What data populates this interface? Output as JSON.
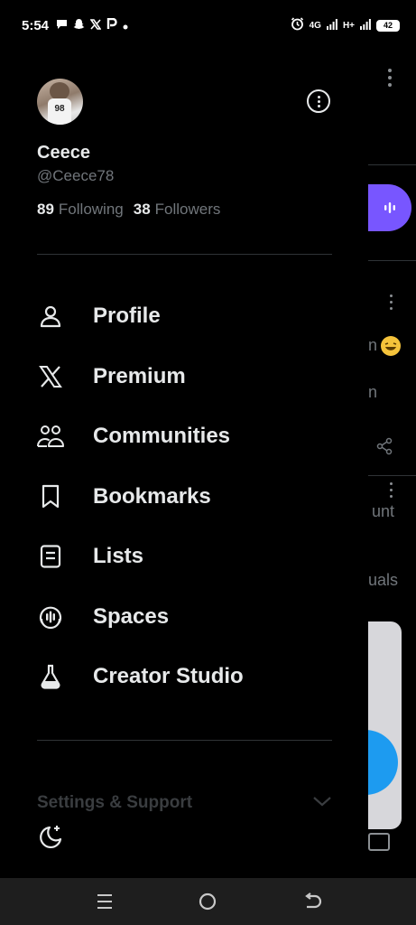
{
  "status_bar": {
    "time": "5:54",
    "network_1": "4G",
    "network_2": "H+",
    "battery": "42"
  },
  "profile": {
    "display_name": "Ceece",
    "handle": "@Ceece78",
    "following_count": "89",
    "following_label": "Following",
    "followers_count": "38",
    "followers_label": "Followers",
    "avatar_jersey": "98"
  },
  "menu": {
    "items": [
      {
        "label": "Profile",
        "icon": "person-icon"
      },
      {
        "label": "Premium",
        "icon": "x-logo-icon"
      },
      {
        "label": "Communities",
        "icon": "communities-icon"
      },
      {
        "label": "Bookmarks",
        "icon": "bookmark-icon"
      },
      {
        "label": "Lists",
        "icon": "list-icon"
      },
      {
        "label": "Spaces",
        "icon": "spaces-icon"
      },
      {
        "label": "Creator Studio",
        "icon": "flask-icon"
      }
    ]
  },
  "settings": {
    "label": "Settings & Support"
  },
  "background_feed": {
    "text_1": "n",
    "text_2": "unt",
    "text_3": "uals"
  },
  "colors": {
    "background": "#000000",
    "text_primary": "#e7e9ea",
    "text_secondary": "#71767b",
    "divider": "#2f3336",
    "spaces_purple": "#7856ff",
    "accent_blue": "#1d9bf0"
  }
}
